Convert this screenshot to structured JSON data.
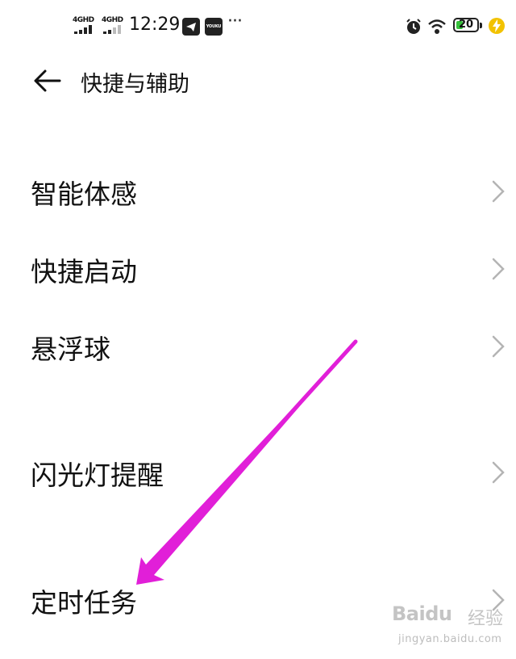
{
  "status_bar": {
    "signal_1_label": "4GHD",
    "signal_2_label": "4GHD",
    "time": "12:29",
    "youku_label": "YOUKU",
    "more": "···",
    "battery_level": "20",
    "icons": [
      "signal-icon",
      "telegram-icon",
      "youku-icon",
      "alarm-icon",
      "wifi-icon",
      "battery-icon",
      "charging-icon"
    ]
  },
  "header": {
    "title": "快捷与辅助"
  },
  "menu": {
    "items": [
      {
        "label": "智能体感"
      },
      {
        "label": "快捷启动"
      },
      {
        "label": "悬浮球"
      },
      {
        "label": "闪光灯提醒"
      },
      {
        "label": "定时任务"
      }
    ]
  },
  "annotation": {
    "arrow_color": "#e11fd8"
  },
  "watermark": {
    "brand": "Baidu",
    "cn": "经验",
    "url": "jingyan.baidu.com"
  },
  "colors": {
    "background": "#ffffff",
    "text": "#111111",
    "chevron": "#b4b4b4",
    "battery_fill": "#36c13b",
    "charge": "#f2c200"
  }
}
